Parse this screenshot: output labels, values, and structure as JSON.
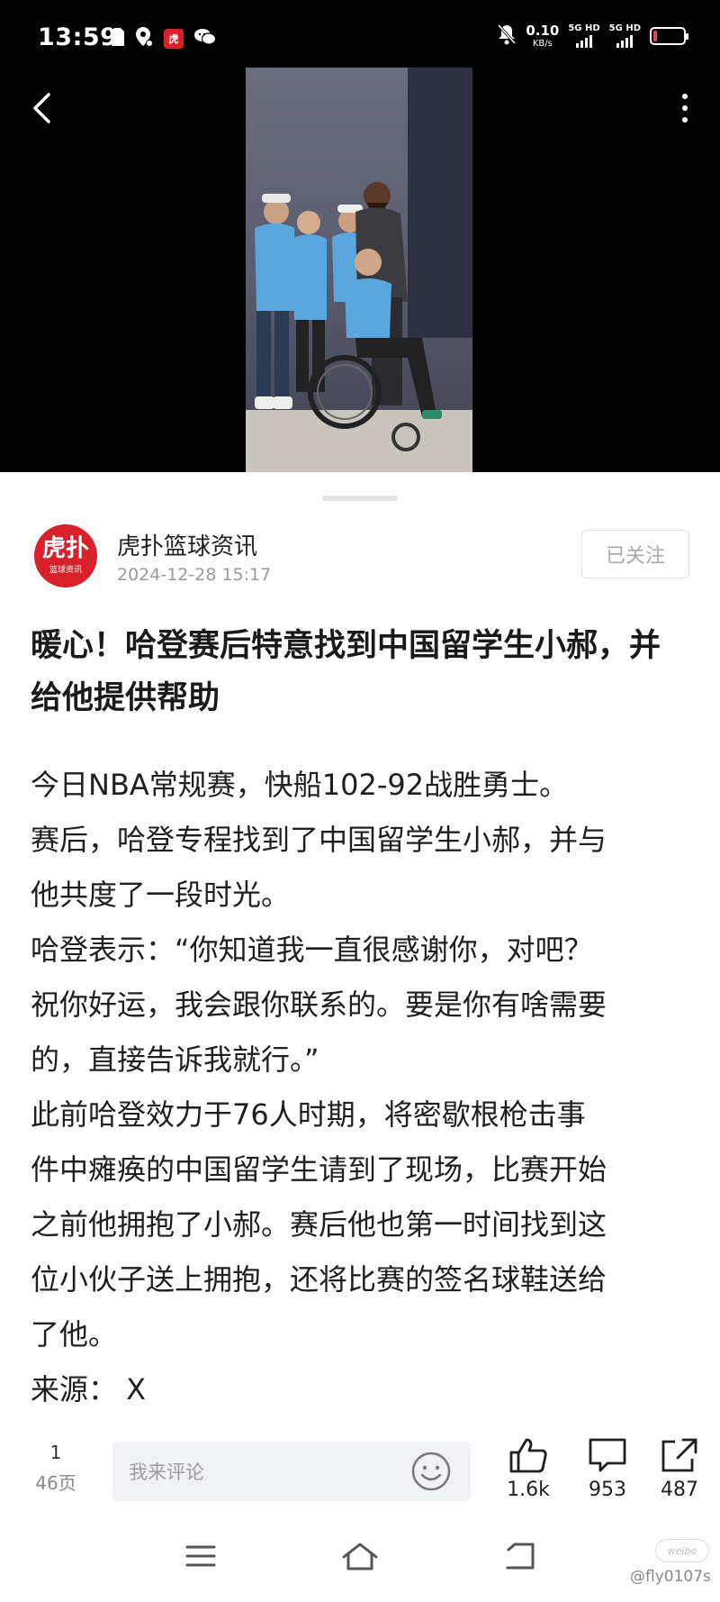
{
  "status_bar": {
    "time": "13:59",
    "net_speed_value": "0.10",
    "net_speed_unit": "KB/s",
    "sim1_label": "5G HD",
    "sim2_label": "5G HD",
    "battery_level": 0.12,
    "icons": [
      "sim-card-icon",
      "location-icon",
      "hupu-app-icon",
      "wechat-icon",
      "mute-icon",
      "battery-icon"
    ]
  },
  "header": {
    "back_icon": "chevron-left-icon",
    "more_icon": "more-vertical-icon"
  },
  "author": {
    "avatar_text": "虎扑",
    "avatar_sub": "篮球资讯",
    "name": "虎扑篮球资讯",
    "datetime": "2024-12-28 15:17",
    "follow_label": "已关注"
  },
  "article": {
    "title": "暖心！哈登赛后特意找到中国留学生小郝，并给他提供帮助",
    "body_lines": [
      "今日NBA常规赛，快船102-92战胜勇士。",
      "赛后，哈登专程找到了中国留学生小郝，并与",
      "他共度了一段时光。",
      "哈登表示：“你知道我一直很感谢你，对吧？",
      "祝你好运，我会跟你联系的。要是你有啥需要",
      "的，直接告诉我就行。”",
      "此前哈登效力于76人时期，将密歇根枪击事",
      "件中瘫痪的中国留学生请到了现场，比赛开始",
      "之前他拥抱了小郝。赛后他也第一时间找到这",
      "位小伙子送上拥抱，还将比赛的签名球鞋送给",
      "了他。",
      "来源： X"
    ]
  },
  "action_bar": {
    "page_current": "1",
    "page_total": "46页",
    "comment_placeholder": "我来评论",
    "likes": "1.6k",
    "comments": "953",
    "shares": "487"
  },
  "watermark": {
    "logo_text": "weibo",
    "user": "@fly0107s"
  }
}
